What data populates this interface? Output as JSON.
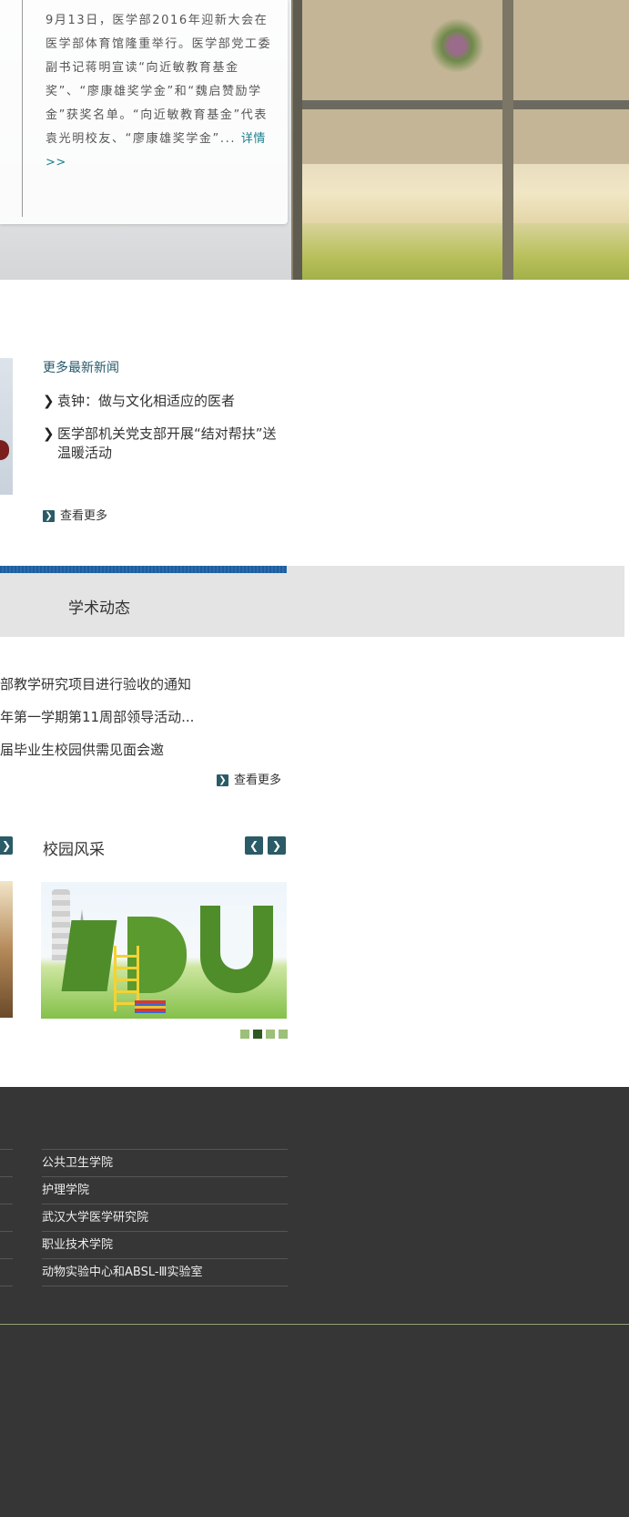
{
  "hero": {
    "summary": "9月13日，医学部2016年迎新大会在医学部体育馆隆重举行。医学部党工委副书记蒋明宣读“向近敏教育基金奖”、“廖康雄奖学金”和“魏启赞励学金”获奖名单。“向近敏教育基金”代表袁光明校友、“廖康雄奖学金”...",
    "more_label": "详情 >>"
  },
  "news": {
    "heading": "更多最新新闻",
    "items": [
      {
        "title": "袁钟：做与文化相适应的医者"
      },
      {
        "title": "医学部机关党支部开展“结对帮扶”送温暖活动"
      }
    ],
    "more_label": "查看更多"
  },
  "academic": {
    "title": "学术动态",
    "items": [
      {
        "title": "部教学研究项目进行验收的通知"
      },
      {
        "title": "年第一学期第11周部领导活动..."
      },
      {
        "title": "届毕业生校园供需见面会邀"
      }
    ],
    "more_label": "查看更多"
  },
  "campus": {
    "title": "校园风采",
    "image_text": "EDU",
    "slide_count": 4,
    "active_slide": 2
  },
  "footer": {
    "links": [
      {
        "label": "公共卫生学院"
      },
      {
        "label": "护理学院"
      },
      {
        "label": "武汉大学医学研究院"
      },
      {
        "label": "职业技术学院"
      },
      {
        "label": "动物实验中心和ABSL-Ⅲ实验室"
      }
    ]
  },
  "colors": {
    "accent_teal": "#2a5b66",
    "link_teal": "#1b7f8c",
    "footer_bg": "#363636",
    "academic_accent": "#1f5c9a"
  }
}
